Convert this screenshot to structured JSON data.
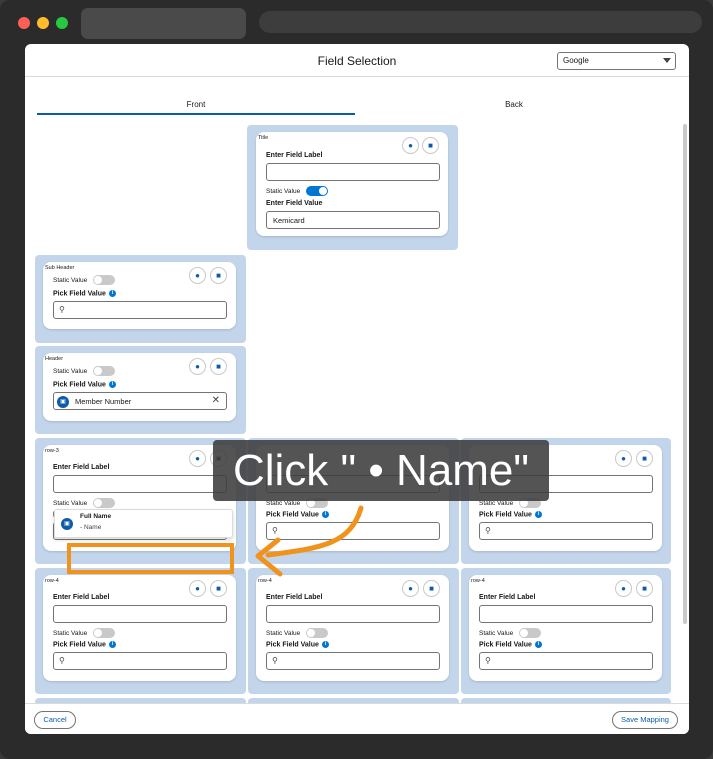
{
  "modal": {
    "title": "Field Selection",
    "select_value": "Google",
    "tabs": [
      "Front",
      "Back"
    ]
  },
  "labels": {
    "enter_field_label": "Enter Field Label",
    "static_value": "Static Value",
    "enter_field_value": "Enter Field Value",
    "pick_field_value": "Pick Field Value"
  },
  "title_card": {
    "slot": "Title",
    "field_value": "Kemicard",
    "static_on": true
  },
  "subheader_card": {
    "slot": "Sub Header"
  },
  "header_card": {
    "slot": "Header",
    "pick_value": "Member Number"
  },
  "row3": {
    "slot": "row-3",
    "search_value": "full"
  },
  "row4": {
    "slot": "row-4"
  },
  "dropdown": {
    "title": "Full Name",
    "option": "- Name"
  },
  "callout": {
    "text": "Click \" • Name\""
  },
  "footer": {
    "cancel": "Cancel",
    "save": "Save Mapping"
  },
  "icons": {
    "bell": "bell-icon",
    "delete": "trash-icon",
    "search": "search-icon",
    "info": "info-icon"
  }
}
